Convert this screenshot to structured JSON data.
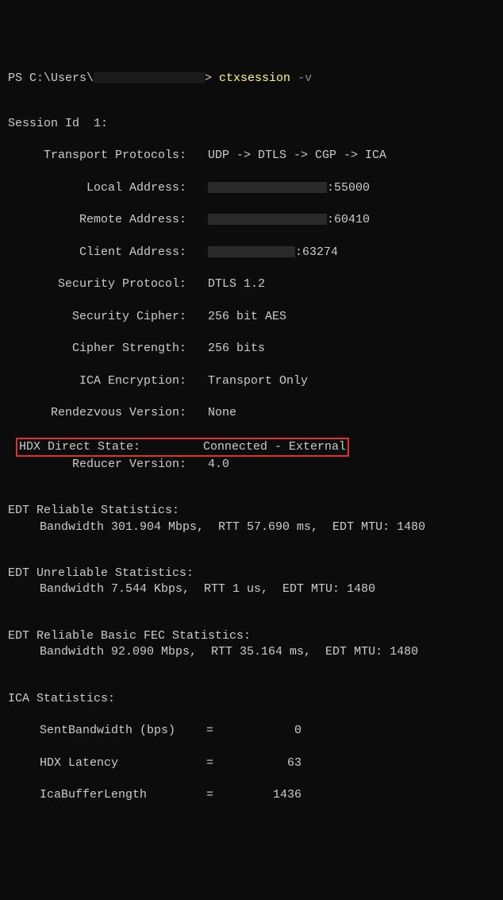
{
  "prompt": {
    "prefix": "PS C:\\Users\\",
    "suffix": "> ",
    "command": "ctxsession",
    "flag": "-v"
  },
  "session": {
    "header": "Session Id  1:",
    "rows": [
      {
        "label": "Transport Protocols:",
        "value": "UDP -> DTLS -> CGP -> ICA",
        "redact": false
      },
      {
        "label": "Local Address:",
        "value": ":55000",
        "redact": true
      },
      {
        "label": "Remote Address:",
        "value": ":60410",
        "redact": true
      },
      {
        "label": "Client Address:",
        "value": ":63274",
        "redact": "sm"
      },
      {
        "label": "Security Protocol:",
        "value": "DTLS 1.2",
        "redact": false
      },
      {
        "label": "Security Cipher:",
        "value": "256 bit AES",
        "redact": false
      },
      {
        "label": "Cipher Strength:",
        "value": "256 bits",
        "redact": false
      },
      {
        "label": "ICA Encryption:",
        "value": "Transport Only",
        "redact": false
      },
      {
        "label": "Rendezvous Version:",
        "value": "None",
        "redact": false
      }
    ],
    "highlighted": {
      "label": "HDX Direct State:",
      "value": "Connected - External"
    },
    "reducer": {
      "label": "Reducer Version:",
      "value": "4.0"
    }
  },
  "edt_reliable": {
    "title": "EDT Reliable Statistics:",
    "line": "Bandwidth 301.904 Mbps,  RTT 57.690 ms,  EDT MTU: 1480"
  },
  "edt_unreliable": {
    "title": "EDT Unreliable Statistics:",
    "line": "Bandwidth 7.544 Kbps,  RTT 1 us,  EDT MTU: 1480"
  },
  "edt_fec": {
    "title": "EDT Reliable Basic FEC Statistics:",
    "line": "Bandwidth 92.090 Mbps,  RTT 35.164 ms,  EDT MTU: 1480"
  },
  "ica": {
    "title": "ICA Statistics:",
    "rows": [
      {
        "label": "SentBandwidth (bps)",
        "value": "0"
      },
      {
        "label": "HDX Latency",
        "value": "63"
      },
      {
        "label": "IcaBufferLength",
        "value": "1436"
      }
    ]
  }
}
